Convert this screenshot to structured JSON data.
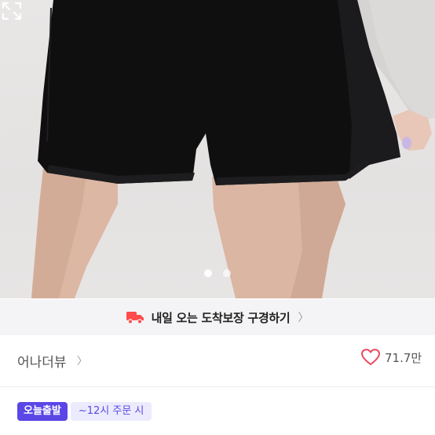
{
  "product_image": {
    "description_icon": "shorts-photo",
    "page_indicator": {
      "current": 1,
      "total": 2
    },
    "expand_icon": "expand-icon"
  },
  "delivery_banner": {
    "icon": "truck-icon",
    "text": "내일 오는 도착보장 구경하기",
    "accent_color": "#ff4b4b"
  },
  "seller": {
    "name": "어나더뷰",
    "like_count": "71.7만",
    "like_icon": "heart-outline-icon",
    "like_color": "#e84a5f"
  },
  "badges": {
    "today_shipping": "오늘출발",
    "cutoff": "~12시 주문 시",
    "accent_color": "#5a47e6"
  }
}
